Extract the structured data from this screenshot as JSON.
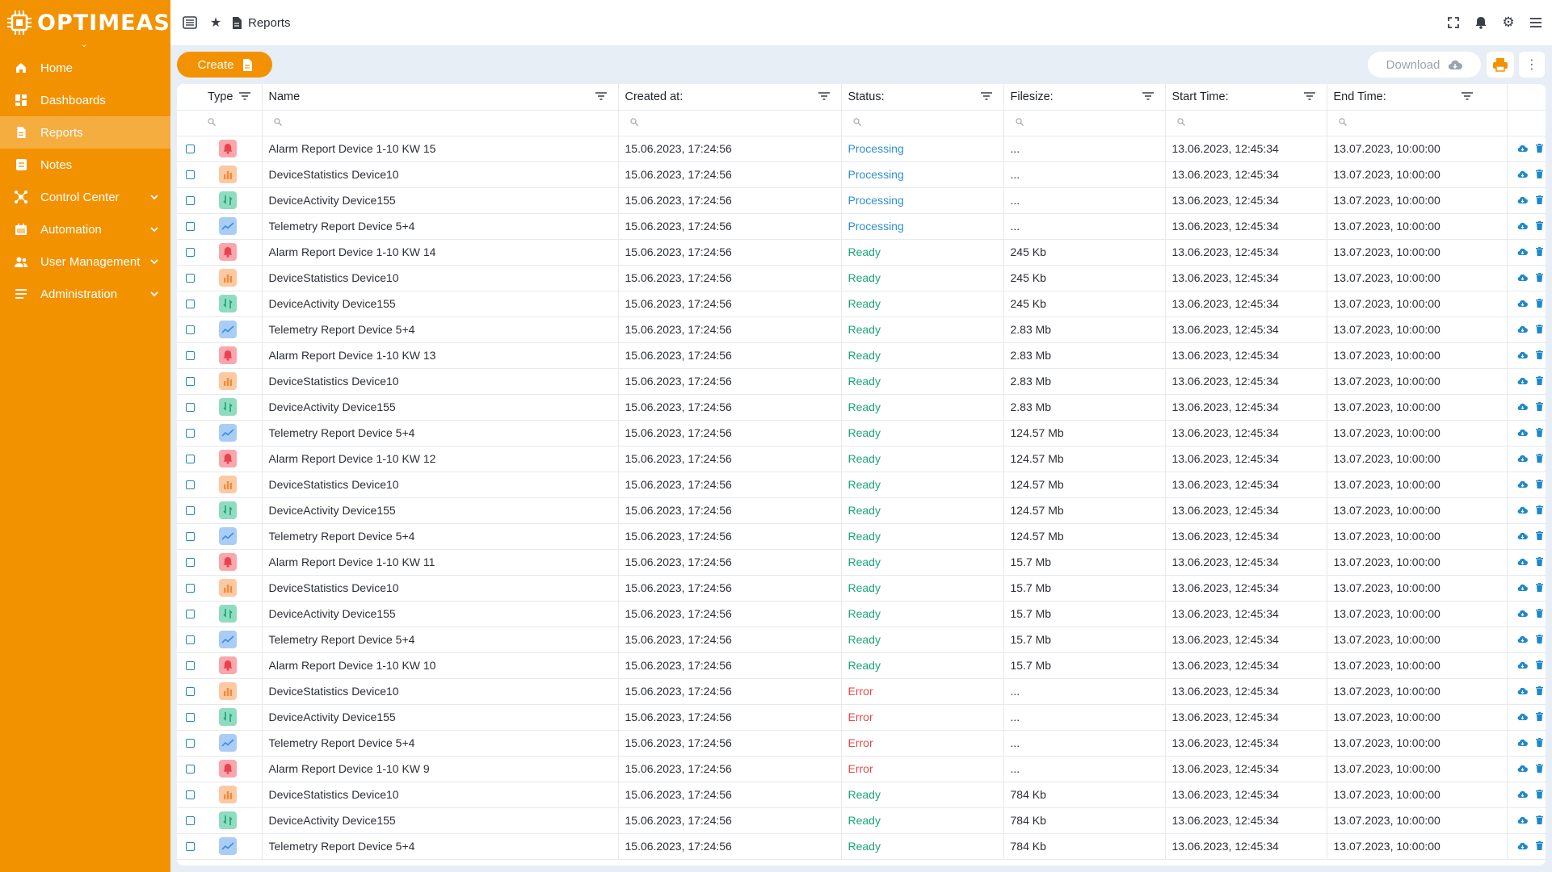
{
  "brand": {
    "name": "OPTIMEAS",
    "color": "#f39200"
  },
  "sidebar": {
    "items": [
      {
        "label": "Home",
        "icon": "home-icon",
        "chevron": false,
        "active": false
      },
      {
        "label": "Dashboards",
        "icon": "dashboard-icon",
        "chevron": false,
        "active": false
      },
      {
        "label": "Reports",
        "icon": "document-icon",
        "chevron": false,
        "active": true
      },
      {
        "label": "Notes",
        "icon": "note-icon",
        "chevron": false,
        "active": false
      },
      {
        "label": "Control Center",
        "icon": "hub-icon",
        "chevron": true,
        "active": false
      },
      {
        "label": "Automation",
        "icon": "calendar-icon",
        "chevron": true,
        "active": false
      },
      {
        "label": "User Management",
        "icon": "users-icon",
        "chevron": true,
        "active": false
      },
      {
        "label": "Administration",
        "icon": "list-icon",
        "chevron": true,
        "active": false
      }
    ]
  },
  "topbar": {
    "breadcrumb": "Reports"
  },
  "toolbar": {
    "create_label": "Create",
    "download_label": "Download"
  },
  "table": {
    "columns": [
      "Type",
      "Name",
      "Created at:",
      "Status:",
      "Filesize:",
      "Start Time:",
      "End Time:"
    ],
    "rows": [
      {
        "type": "alarm",
        "name": "Alarm Report Device 1-10 KW 15",
        "created": "15.06.2023, 17:24:56",
        "status": "Processing",
        "filesize": "...",
        "start": "13.06.2023, 12:45:34",
        "end": "13.07.2023, 10:00:00"
      },
      {
        "type": "stats",
        "name": "DeviceStatistics Device10",
        "created": "15.06.2023, 17:24:56",
        "status": "Processing",
        "filesize": "...",
        "start": "13.06.2023, 12:45:34",
        "end": "13.07.2023, 10:00:00"
      },
      {
        "type": "activity",
        "name": "DeviceActivity Device155",
        "created": "15.06.2023, 17:24:56",
        "status": "Processing",
        "filesize": "...",
        "start": "13.06.2023, 12:45:34",
        "end": "13.07.2023, 10:00:00"
      },
      {
        "type": "telemetry",
        "name": "Telemetry Report Device 5+4",
        "created": "15.06.2023, 17:24:56",
        "status": "Processing",
        "filesize": "...",
        "start": "13.06.2023, 12:45:34",
        "end": "13.07.2023, 10:00:00"
      },
      {
        "type": "alarm",
        "name": "Alarm Report Device 1-10 KW 14",
        "created": "15.06.2023, 17:24:56",
        "status": "Ready",
        "filesize": "245 Kb",
        "start": "13.06.2023, 12:45:34",
        "end": "13.07.2023, 10:00:00"
      },
      {
        "type": "stats",
        "name": "DeviceStatistics Device10",
        "created": "15.06.2023, 17:24:56",
        "status": "Ready",
        "filesize": "245 Kb",
        "start": "13.06.2023, 12:45:34",
        "end": "13.07.2023, 10:00:00"
      },
      {
        "type": "activity",
        "name": "DeviceActivity Device155",
        "created": "15.06.2023, 17:24:56",
        "status": "Ready",
        "filesize": "245 Kb",
        "start": "13.06.2023, 12:45:34",
        "end": "13.07.2023, 10:00:00"
      },
      {
        "type": "telemetry",
        "name": "Telemetry Report Device 5+4",
        "created": "15.06.2023, 17:24:56",
        "status": "Ready",
        "filesize": "2.83 Mb",
        "start": "13.06.2023, 12:45:34",
        "end": "13.07.2023, 10:00:00"
      },
      {
        "type": "alarm",
        "name": "Alarm Report Device 1-10 KW 13",
        "created": "15.06.2023, 17:24:56",
        "status": "Ready",
        "filesize": "2.83 Mb",
        "start": "13.06.2023, 12:45:34",
        "end": "13.07.2023, 10:00:00"
      },
      {
        "type": "stats",
        "name": "DeviceStatistics Device10",
        "created": "15.06.2023, 17:24:56",
        "status": "Ready",
        "filesize": "2.83 Mb",
        "start": "13.06.2023, 12:45:34",
        "end": "13.07.2023, 10:00:00"
      },
      {
        "type": "activity",
        "name": "DeviceActivity Device155",
        "created": "15.06.2023, 17:24:56",
        "status": "Ready",
        "filesize": "2.83 Mb",
        "start": "13.06.2023, 12:45:34",
        "end": "13.07.2023, 10:00:00"
      },
      {
        "type": "telemetry",
        "name": "Telemetry Report Device 5+4",
        "created": "15.06.2023, 17:24:56",
        "status": "Ready",
        "filesize": "124.57 Mb",
        "start": "13.06.2023, 12:45:34",
        "end": "13.07.2023, 10:00:00"
      },
      {
        "type": "alarm",
        "name": "Alarm Report Device 1-10 KW 12",
        "created": "15.06.2023, 17:24:56",
        "status": "Ready",
        "filesize": "124.57 Mb",
        "start": "13.06.2023, 12:45:34",
        "end": "13.07.2023, 10:00:00"
      },
      {
        "type": "stats",
        "name": "DeviceStatistics Device10",
        "created": "15.06.2023, 17:24:56",
        "status": "Ready",
        "filesize": "124.57 Mb",
        "start": "13.06.2023, 12:45:34",
        "end": "13.07.2023, 10:00:00"
      },
      {
        "type": "activity",
        "name": "DeviceActivity Device155",
        "created": "15.06.2023, 17:24:56",
        "status": "Ready",
        "filesize": "124.57 Mb",
        "start": "13.06.2023, 12:45:34",
        "end": "13.07.2023, 10:00:00"
      },
      {
        "type": "telemetry",
        "name": "Telemetry Report Device 5+4",
        "created": "15.06.2023, 17:24:56",
        "status": "Ready",
        "filesize": "124.57 Mb",
        "start": "13.06.2023, 12:45:34",
        "end": "13.07.2023, 10:00:00"
      },
      {
        "type": "alarm",
        "name": "Alarm Report Device 1-10 KW 11",
        "created": "15.06.2023, 17:24:56",
        "status": "Ready",
        "filesize": "15.7 Mb",
        "start": "13.06.2023, 12:45:34",
        "end": "13.07.2023, 10:00:00"
      },
      {
        "type": "stats",
        "name": "DeviceStatistics Device10",
        "created": "15.06.2023, 17:24:56",
        "status": "Ready",
        "filesize": "15.7 Mb",
        "start": "13.06.2023, 12:45:34",
        "end": "13.07.2023, 10:00:00"
      },
      {
        "type": "activity",
        "name": "DeviceActivity Device155",
        "created": "15.06.2023, 17:24:56",
        "status": "Ready",
        "filesize": "15.7 Mb",
        "start": "13.06.2023, 12:45:34",
        "end": "13.07.2023, 10:00:00"
      },
      {
        "type": "telemetry",
        "name": "Telemetry Report Device 5+4",
        "created": "15.06.2023, 17:24:56",
        "status": "Ready",
        "filesize": "15.7 Mb",
        "start": "13.06.2023, 12:45:34",
        "end": "13.07.2023, 10:00:00"
      },
      {
        "type": "alarm",
        "name": "Alarm Report Device 1-10 KW 10",
        "created": "15.06.2023, 17:24:56",
        "status": "Ready",
        "filesize": "15.7 Mb",
        "start": "13.06.2023, 12:45:34",
        "end": "13.07.2023, 10:00:00"
      },
      {
        "type": "stats",
        "name": "DeviceStatistics Device10",
        "created": "15.06.2023, 17:24:56",
        "status": "Error",
        "filesize": "...",
        "start": "13.06.2023, 12:45:34",
        "end": "13.07.2023, 10:00:00"
      },
      {
        "type": "activity",
        "name": "DeviceActivity Device155",
        "created": "15.06.2023, 17:24:56",
        "status": "Error",
        "filesize": "...",
        "start": "13.06.2023, 12:45:34",
        "end": "13.07.2023, 10:00:00"
      },
      {
        "type": "telemetry",
        "name": "Telemetry Report Device 5+4",
        "created": "15.06.2023, 17:24:56",
        "status": "Error",
        "filesize": "...",
        "start": "13.06.2023, 12:45:34",
        "end": "13.07.2023, 10:00:00"
      },
      {
        "type": "alarm",
        "name": "Alarm Report Device 1-10 KW 9",
        "created": "15.06.2023, 17:24:56",
        "status": "Error",
        "filesize": "...",
        "start": "13.06.2023, 12:45:34",
        "end": "13.07.2023, 10:00:00"
      },
      {
        "type": "stats",
        "name": "DeviceStatistics Device10",
        "created": "15.06.2023, 17:24:56",
        "status": "Ready",
        "filesize": "784 Kb",
        "start": "13.06.2023, 12:45:34",
        "end": "13.07.2023, 10:00:00"
      },
      {
        "type": "activity",
        "name": "DeviceActivity Device155",
        "created": "15.06.2023, 17:24:56",
        "status": "Ready",
        "filesize": "784 Kb",
        "start": "13.06.2023, 12:45:34",
        "end": "13.07.2023, 10:00:00"
      },
      {
        "type": "telemetry",
        "name": "Telemetry Report Device 5+4",
        "created": "15.06.2023, 17:24:56",
        "status": "Ready",
        "filesize": "784 Kb",
        "start": "13.06.2023, 12:45:34",
        "end": "13.07.2023, 10:00:00"
      }
    ]
  },
  "colors": {
    "processing": "#2f8fcf",
    "ready": "#1aa57a",
    "error": "#e24b4b",
    "alarm": "#e8424f",
    "stats": "#f08a3c",
    "activity": "#1aa57a",
    "telemetry": "#3b8ee8"
  }
}
